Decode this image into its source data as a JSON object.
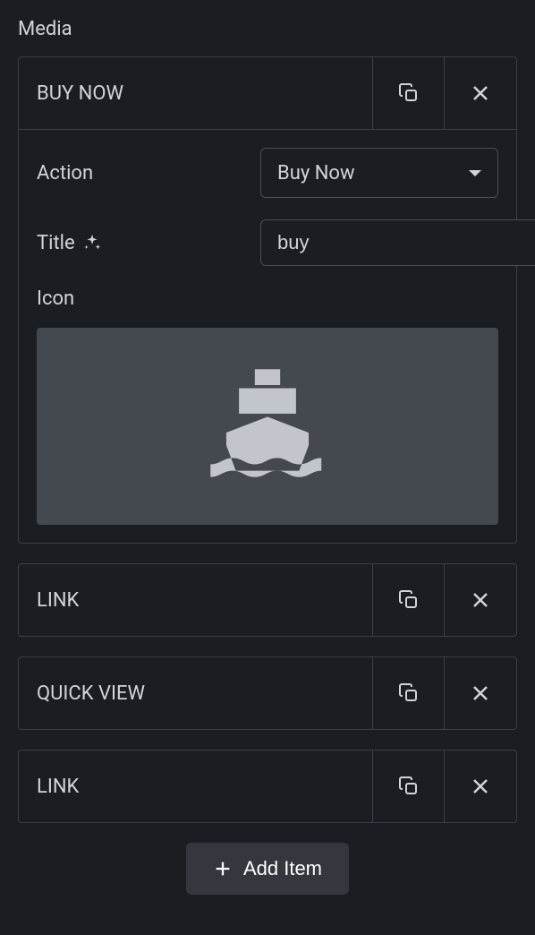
{
  "section": {
    "title": "Media"
  },
  "items": [
    {
      "label": "BUY NOW",
      "expanded": true,
      "body": {
        "action_label": "Action",
        "action_value": "Buy Now",
        "title_label": "Title",
        "title_value": "buy",
        "icon_label": "Icon",
        "icon_name": "boat"
      }
    },
    {
      "label": "LINK",
      "expanded": false
    },
    {
      "label": "QUICK VIEW",
      "expanded": false
    },
    {
      "label": "LINK",
      "expanded": false
    }
  ],
  "add_button": {
    "label": "Add Item"
  }
}
